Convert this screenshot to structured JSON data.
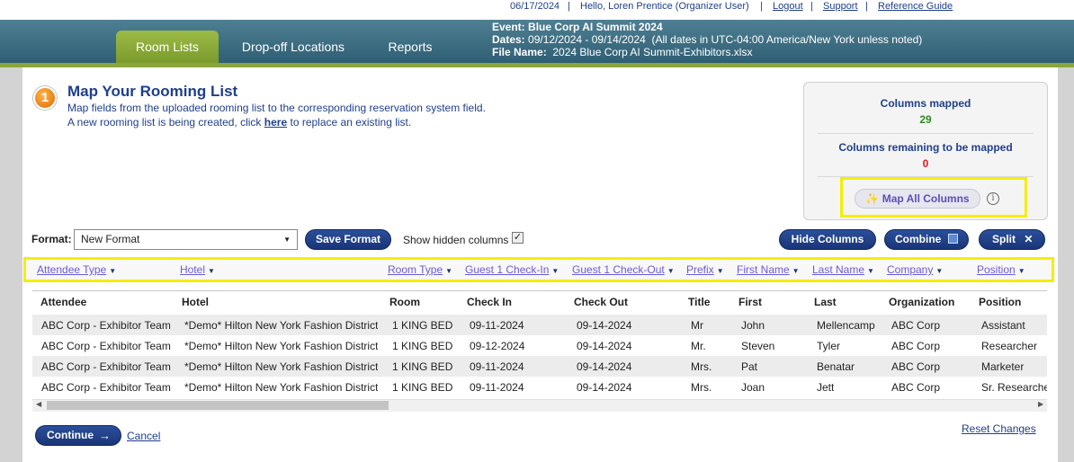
{
  "topbar": {
    "date": "06/17/2024",
    "greeting": "Hello, Loren  Prentice (Organizer User)",
    "logout": "Logout",
    "support": "Support",
    "reference_guide": "Reference Guide",
    "separator": "|"
  },
  "tabs": [
    {
      "label": "Room Lists",
      "active": true
    },
    {
      "label": "Drop-off Locations",
      "active": false
    },
    {
      "label": "Reports",
      "active": false
    }
  ],
  "event": {
    "event_label": "Event:",
    "event_value": "Blue Corp AI Summit 2024",
    "dates_label": "Dates:",
    "dates_value": "09/12/2024 - 09/14/2024",
    "dates_note": "(All dates in UTC-04:00 America/New York unless noted)",
    "file_label": "File Name:",
    "file_value": "2024 Blue Corp AI Summit-Exhibitors.xlsx"
  },
  "step": {
    "number": "1",
    "title": "Map Your Rooming List",
    "desc_line1": "Map fields from the uploaded rooming list to the corresponding reservation system field.",
    "desc_line2_pre": "A new rooming list is being created, click",
    "desc_line2_link": "here",
    "desc_line2_post": "to replace an existing list."
  },
  "columns_panel": {
    "mapped_label": "Columns mapped",
    "mapped_value": "29",
    "remaining_label": "Columns remaining to be mapped",
    "remaining_value": "0",
    "map_all_label": "Map All Columns",
    "map_all_icon": "sparkle-icon",
    "info_icon": "info-icon",
    "colors": {
      "mapped": "#2e8b1f",
      "remaining": "#d42020"
    }
  },
  "format": {
    "label": "Format:",
    "selected": "New Format",
    "save_label": "Save Format",
    "show_hidden_label": "Show hidden columns",
    "show_hidden_checked": true,
    "hide_columns_label": "Hide Columns",
    "combine_label": "Combine",
    "split_label": "Split"
  },
  "mapping": [
    "Attendee Type",
    "Hotel",
    "Room Type",
    "Guest 1 Check-In",
    "Guest 1 Check-Out",
    "Prefix",
    "First Name",
    "Last Name",
    "Company",
    "Position"
  ],
  "table": {
    "headers": [
      "Attendee",
      "Hotel",
      "Room",
      "Check In",
      "Check Out",
      "Title",
      "First",
      "Last",
      "Organization",
      "Position"
    ],
    "rows": [
      [
        "ABC Corp - Exhibitor Team",
        "*Demo* Hilton New York Fashion District",
        "1 KING BED",
        "09-11-2024",
        "09-14-2024",
        "Mr",
        "John",
        "Mellencamp",
        "ABC Corp",
        "Assistant"
      ],
      [
        "ABC Corp - Exhibitor Team",
        "*Demo* Hilton New York Fashion District",
        "1 KING BED",
        "09-12-2024",
        "09-14-2024",
        "Mr.",
        "Steven",
        "Tyler",
        "ABC Corp",
        "Researcher"
      ],
      [
        "ABC Corp - Exhibitor Team",
        "*Demo* Hilton New York Fashion District",
        "1 KING BED",
        "09-11-2024",
        "09-14-2024",
        "Mrs.",
        "Pat",
        "Benatar",
        "ABC Corp",
        "Marketer"
      ],
      [
        "ABC Corp - Exhibitor Team",
        "*Demo* Hilton New York Fashion District",
        "1 KING BED",
        "09-11-2024",
        "09-14-2024",
        "Mrs.",
        "Joan",
        "Jett",
        "ABC Corp",
        "Sr. Researcher"
      ]
    ]
  },
  "footer": {
    "continue_label": "Continue",
    "cancel_label": "Cancel",
    "reset_label": "Reset Changes"
  }
}
